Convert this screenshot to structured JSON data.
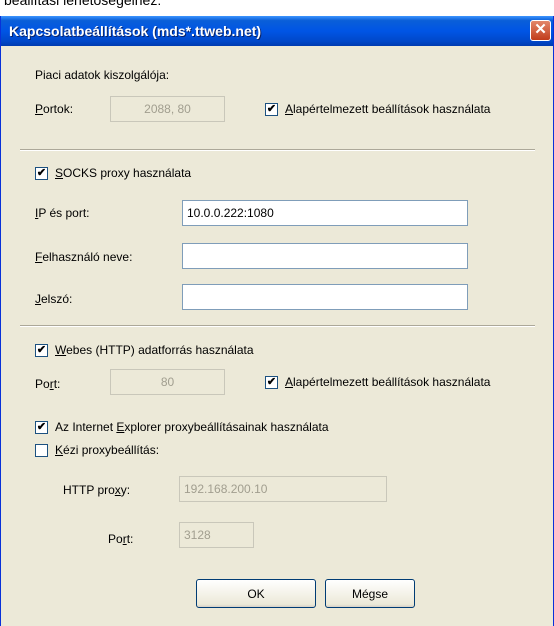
{
  "page_caption": "beállítási lehetőségeinez:",
  "dialog": {
    "title": "Kapcsolatbeállítások (mds*.ttweb.net)",
    "close_symbol": "✕"
  },
  "market_server": {
    "heading": "Piaci adatok kiszolgálója:",
    "ports_label_mnemonic": "P",
    "ports_label_rest": "ortok:",
    "ports_value": "2088, 80",
    "default_mnemonic": "A",
    "default_label_rest": "lapértelmezett beállítások használata",
    "default_checked": true
  },
  "socks": {
    "use_mnemonic": "S",
    "use_label_rest": "OCKS proxy használata",
    "use_checked": true,
    "ip_mnemonic": "I",
    "ip_label_rest": "P és port:",
    "ip_value": "10.0.0.222:1080",
    "user_mnemonic": "F",
    "user_label_rest": "elhasználó neve:",
    "user_value": "",
    "password_mnemonic": "J",
    "password_label_rest": "elszó:",
    "password_value": ""
  },
  "http": {
    "use_mnemonic": "W",
    "use_label_rest": "ebes (HTTP) adatforrás használata",
    "use_checked": true,
    "port_label_pre": "Po",
    "port_mnemonic": "r",
    "port_label_post": "t:",
    "port_value": "80",
    "default_mnemonic": "A",
    "default_label_rest": "lapértelmezett beállítások használata",
    "default_checked": true
  },
  "ie_proxy": {
    "label_pre": "Az Internet ",
    "mnemonic": "E",
    "label_post": "xplorer proxybeállításainak használata",
    "checked": true
  },
  "manual_proxy": {
    "mnemonic": "K",
    "label_rest": "ézi proxybeállítás:",
    "checked": false,
    "http_proxy_label_pre": "HTTP pro",
    "http_proxy_mnemonic": "x",
    "http_proxy_label_post": "y:",
    "http_proxy_value": "192.168.200.10",
    "port_label_pre": "Po",
    "port_mnemonic": "r",
    "port_label_post": "t:",
    "port_value": "3128"
  },
  "buttons": {
    "ok": "OK",
    "cancel": "Mégse"
  },
  "check_mark": "✔"
}
